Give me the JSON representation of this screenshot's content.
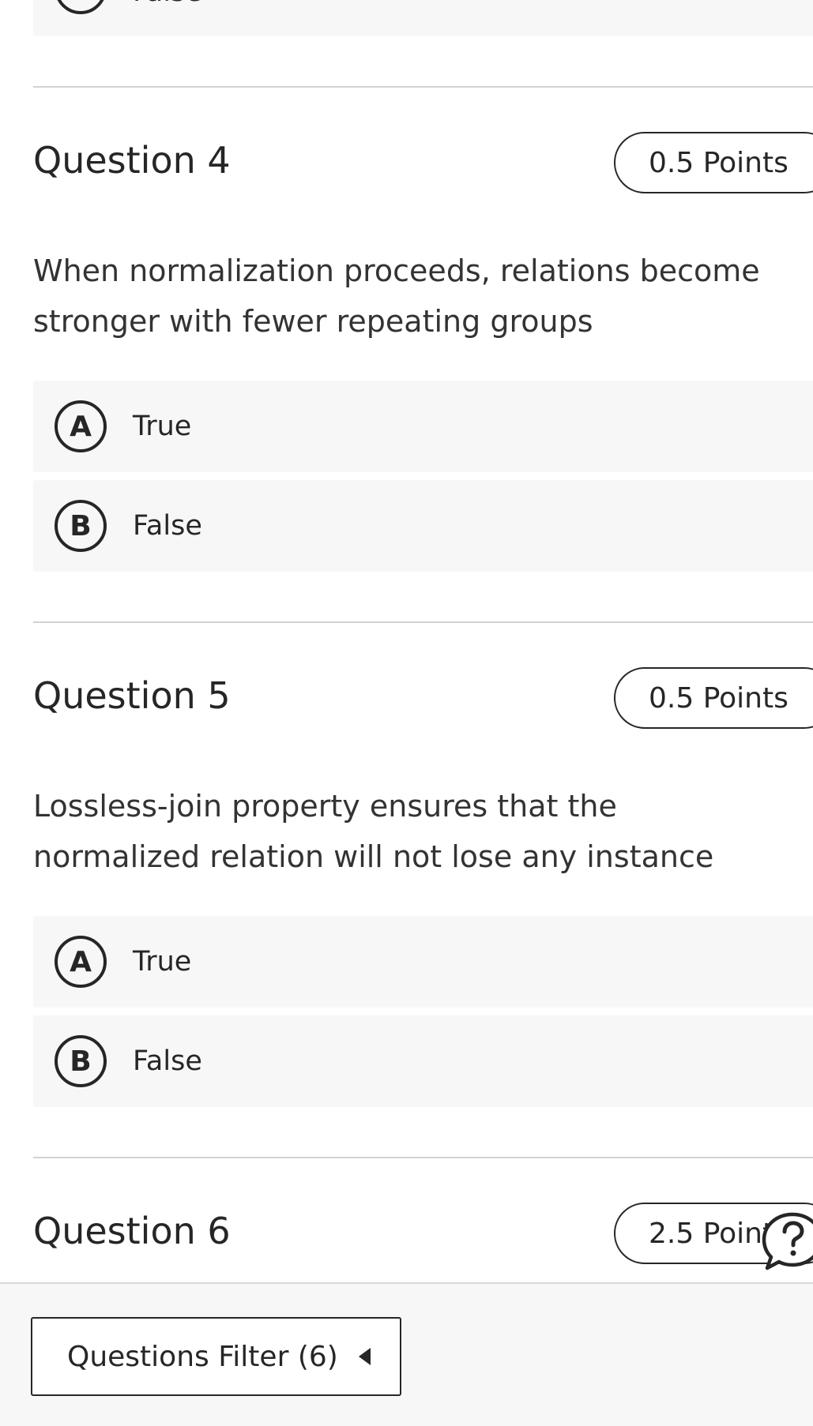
{
  "top_partial": {
    "letter": "B",
    "label": "False"
  },
  "questions": [
    {
      "title": "Question 4",
      "points": "0.5 Points",
      "text": "When normalization proceeds, relations become stronger with fewer repeating groups",
      "options": [
        {
          "letter": "A",
          "label": "True"
        },
        {
          "letter": "B",
          "label": "False"
        }
      ]
    },
    {
      "title": "Question 5",
      "points": "0.5 Points",
      "text": "Lossless-join property ensures that the normalized relation will not lose any instance",
      "options": [
        {
          "letter": "A",
          "label": "True"
        },
        {
          "letter": "B",
          "label": "False"
        }
      ]
    },
    {
      "title": "Question 6",
      "points": "2.5 Points"
    }
  ],
  "bottom_bar": {
    "filter_label": "Questions Filter (6)"
  },
  "icons": {
    "help": "help-chat-icon",
    "filter_caret": "caret-left-icon"
  }
}
